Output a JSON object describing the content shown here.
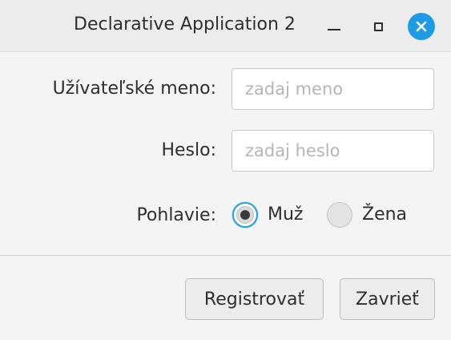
{
  "window": {
    "title": "Declarative Application 2"
  },
  "form": {
    "username_label": "Užívateľské meno:",
    "username_value": "",
    "username_placeholder": "zadaj meno",
    "password_label": "Heslo:",
    "password_value": "",
    "password_placeholder": "zadaj heslo",
    "gender_label": "Pohlavie:",
    "gender_options": [
      {
        "label": "Muž",
        "selected": true
      },
      {
        "label": "Žena",
        "selected": false
      }
    ]
  },
  "buttons": {
    "register_label": "Registrovať",
    "close_label": "Zavrieť"
  },
  "icons": {
    "minimize": "minimize-icon",
    "maximize": "maximize-icon",
    "close": "close-icon"
  },
  "colors": {
    "accent": "#1f9be6",
    "focus_ring": "#2a9fd8",
    "background": "#f4f4f4",
    "titlebar": "#ececec"
  }
}
